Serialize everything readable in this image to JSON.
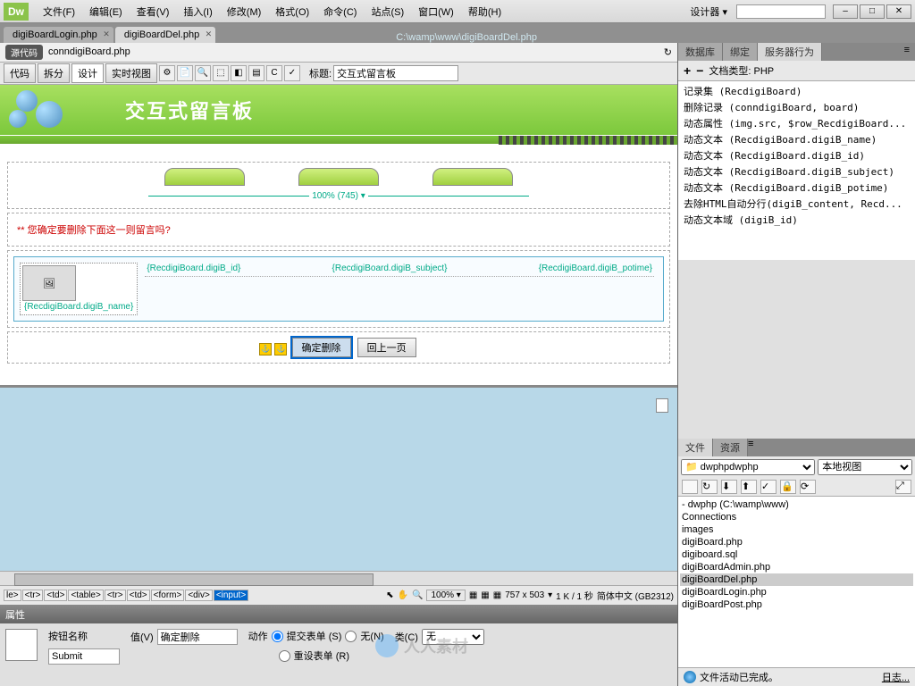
{
  "menu": {
    "items": [
      "文件(F)",
      "编辑(E)",
      "查看(V)",
      "插入(I)",
      "修改(M)",
      "格式(O)",
      "命令(C)",
      "站点(S)",
      "窗口(W)",
      "帮助(H)"
    ],
    "designer": "设计器",
    "dw": "Dw"
  },
  "tabs": {
    "t1": "digiBoardLogin.php",
    "t2": "digiBoardDel.php",
    "path": "C:\\wamp\\www\\digiBoardDel.php"
  },
  "subbar": {
    "badge": "源代码",
    "file": "conndigiBoard.php"
  },
  "viewbar": {
    "code": "代码",
    "split": "拆分",
    "design": "设计",
    "live": "实时视图",
    "title_label": "标题:",
    "title_value": "交互式留言板"
  },
  "banner": {
    "title": "交互式留言板"
  },
  "ruler": "100% (745)",
  "warning": "** 您确定要删除下面这一则留言吗?",
  "fields": {
    "name": "{RecdigiBoard.digiB_name}",
    "id": "{RecdigiBoard.digiB_id}",
    "subject": "{RecdigiBoard.digiB_subject}",
    "potime": "{RecdigiBoard.digiB_potime}"
  },
  "buttons": {
    "confirm": "确定删除",
    "back": "回上一页"
  },
  "status": {
    "tags": [
      "le>",
      "<tr>",
      "<td>",
      "<table>",
      "<tr>",
      "<td>",
      "<form>",
      "<div>",
      "<input>"
    ],
    "zoom": "100%",
    "dims": "757 x 503",
    "size": "1 K / 1 秒",
    "enc": "简体中文 (GB2312)"
  },
  "props": {
    "title": "属性",
    "name_label": "按钮名称",
    "name_value": "Submit",
    "value_label": "值(V)",
    "value_value": "确定删除",
    "action_label": "动作",
    "submit_form": "提交表单 (S)",
    "none": "无(N)",
    "reset_form": "重设表单 (R)",
    "class_label": "类(C)",
    "class_value": "无"
  },
  "right": {
    "tabs1": [
      "数据库",
      "绑定",
      "服务器行为"
    ],
    "doc_type": "文档类型: PHP",
    "behaviors": [
      "记录集 (RecdigiBoard)",
      "删除记录 (conndigiBoard, board)",
      "动态属性 (img.src, $row_RecdigiBoard...",
      "动态文本 (RecdigiBoard.digiB_name)",
      "动态文本 (RecdigiBoard.digiB_id)",
      "动态文本 (RecdigiBoard.digiB_subject)",
      "动态文本 (RecdigiBoard.digiB_potime)",
      "去除HTML自动分行(digiB_content, Recd...",
      "动态文本域 (digiB_id)"
    ],
    "tabs2": [
      "文件",
      "资源"
    ],
    "site": "dwphp",
    "view": "本地视图",
    "tree": [
      "- dwphp (C:\\wamp\\www)",
      "Connections",
      "images",
      "digiBoard.php",
      "digiboard.sql",
      "digiBoardAdmin.php",
      "digiBoardDel.php",
      "digiBoardLogin.php",
      "digiBoardPost.php"
    ],
    "status": "文件活动已完成。",
    "log": "日志..."
  },
  "watermark": "人人素材"
}
